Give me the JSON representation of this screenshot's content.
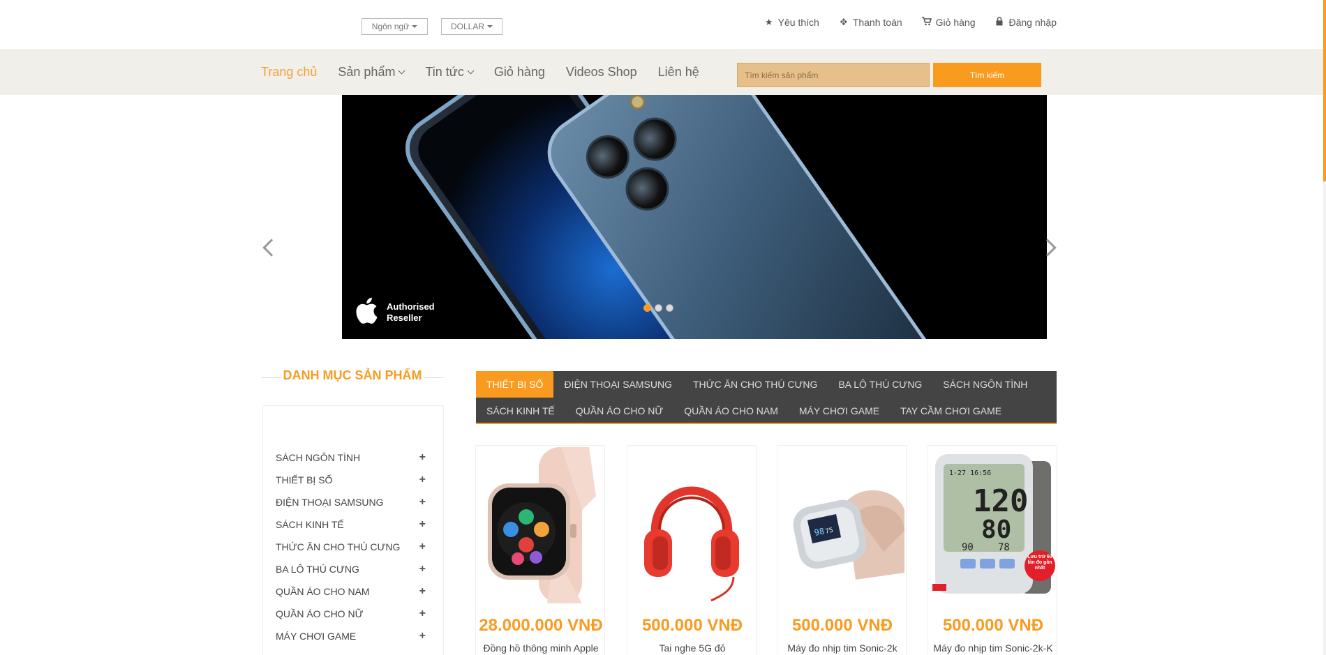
{
  "top": {
    "language": "Ngôn ngữ",
    "currency": "DOLLAR",
    "links": [
      {
        "label": "Yêu thích",
        "icon": "star-icon"
      },
      {
        "label": "Thanh toán",
        "icon": "crosshair-icon"
      },
      {
        "label": "Giỏ hàng",
        "icon": "cart-icon"
      },
      {
        "label": "Đăng nhập",
        "icon": "lock-icon"
      }
    ]
  },
  "nav": {
    "items": [
      "Trang chủ",
      "Sản phẩm",
      "Tin tức",
      "Giỏ hàng",
      "Videos Shop",
      "Liên hệ"
    ],
    "search_placeholder": "Tìm kiếm sản phẩm",
    "search_button": "Tìm kiếm"
  },
  "slider": {
    "badge_line1": "Authorised",
    "badge_line2": "Reseller"
  },
  "sidebar": {
    "title": "DANH MỤC SẢN PHẨM",
    "items": [
      "SÁCH NGÔN TÌNH",
      "THIẾT BỊ SỐ",
      "ĐIỆN THOẠI SAMSUNG",
      "SÁCH KINH TẾ",
      "THỨC ĂN CHO THÚ CƯNG",
      "BA LÔ THÚ CƯNG",
      "QUẦN ÁO CHO NAM",
      "QUẦN ÁO CHO NỮ",
      "MÁY CHƠI GAME"
    ]
  },
  "tabs": {
    "row1": [
      "THIẾT BỊ SỐ",
      "ĐIỆN THOẠI SAMSUNG",
      "THỨC ĂN CHO THÚ CƯNG",
      "BA LÔ THÚ CƯNG",
      "SÁCH NGÔN TÌNH"
    ],
    "row2": [
      "SÁCH KINH TẾ",
      "QUẦN ÁO CHO NỮ",
      "QUẦN ÁO CHO NAM",
      "MÁY CHƠI GAME",
      "TAY CẦM CHƠI GAME"
    ]
  },
  "products": [
    {
      "price": "28.000.000 VNĐ",
      "name": "Đồng hồ thông minh Apple"
    },
    {
      "price": "500.000 VNĐ",
      "name": "Tai nghe 5G đỏ"
    },
    {
      "price": "500.000 VNĐ",
      "name": "Máy đo nhịp tim Sonic-2k"
    },
    {
      "price": "500.000 VNĐ",
      "name": "Máy đo nhịp tim Sonic-2k-K"
    }
  ],
  "monitor": {
    "time": "1-27 16:56",
    "sys": "120",
    "dia": "80",
    "pulse": "90",
    "pulse2": "78",
    "badge": "Lưu trữ 60 lần đo gần nhất"
  },
  "oximeter": {
    "reading": "98",
    "reading2": "75"
  },
  "colors": {
    "accent": "#f99b1f",
    "tabbar": "#444444",
    "navbar": "#f0efe9"
  }
}
